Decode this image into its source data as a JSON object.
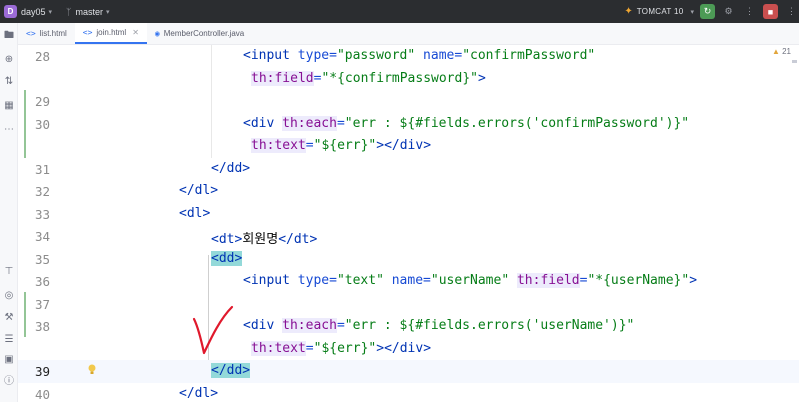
{
  "titlebar": {
    "project_badge": "D",
    "project_name": "day05",
    "branch": "master",
    "run_config": "TOMCAT 10"
  },
  "tabs": [
    {
      "label": "list.html",
      "icon": "html-file-icon",
      "active": false
    },
    {
      "label": "join.html",
      "icon": "html-file-icon",
      "active": true
    },
    {
      "label": "MemberController.java",
      "icon": "java-class-icon",
      "active": false
    }
  ],
  "editor": {
    "warnings_count": "21",
    "current_line": 39,
    "lines": [
      {
        "n": "28",
        "indent": 225
      },
      {
        "n": "",
        "indent": 235
      },
      {
        "n": "29",
        "indent": 0
      },
      {
        "n": "30",
        "indent": 225
      },
      {
        "n": "",
        "indent": 235
      },
      {
        "n": "31",
        "indent": 193
      },
      {
        "n": "32",
        "indent": 161
      },
      {
        "n": "33",
        "indent": 161
      },
      {
        "n": "34",
        "indent": 193
      },
      {
        "n": "35",
        "indent": 193
      },
      {
        "n": "36",
        "indent": 225
      },
      {
        "n": "37",
        "indent": 0
      },
      {
        "n": "38",
        "indent": 225
      },
      {
        "n": "",
        "indent": 235
      },
      {
        "n": "39",
        "indent": 193
      },
      {
        "n": "40",
        "indent": 161
      }
    ],
    "text": {
      "l28a": "<input",
      "l28b": " type=",
      "l28c": "\"password\"",
      "l28d": " name=",
      "l28e": "\"confirmPassword\"",
      "l28f": "th:field",
      "l28g": "=",
      "l28h": "\"*{confirmPassword}\"",
      "l28i": ">",
      "l30a": "<div",
      "l30b": "th:each",
      "l30c": "=",
      "l30d": "\"err : ${#fields.errors('confirmPassword')}\"",
      "l30e": "th:text",
      "l30f": "=",
      "l30g": "\"${err}\"",
      "l30h": "></div>",
      "l31": "</dd>",
      "l32": "</dl>",
      "l33": "<dl>",
      "l34a": "<dt>",
      "l34b": "회원명",
      "l34c": "</dt>",
      "l35": "<dd>",
      "l36a": "<input",
      "l36b": " type=",
      "l36c": "\"text\"",
      "l36d": " name=",
      "l36e": "\"userName\"",
      "l36f": "th:field",
      "l36g": "=",
      "l36h": "\"*{userName}\"",
      "l36i": ">",
      "l38a": "<div",
      "l38b": "th:each",
      "l38c": "=",
      "l38d": "\"err : ${#fields.errors('userName')}\"",
      "l38e": "th:text",
      "l38f": "=",
      "l38g": "\"${err}\"",
      "l38h": "></div>",
      "l39": "</dd>",
      "l40": "</dl>"
    }
  },
  "colors": {
    "accent": "#3574f0",
    "tag": "#0033b3",
    "attribute": "#174ad4",
    "thymeleaf_attr": "#871094",
    "string": "#067d17",
    "annotation_mark": "#e0192c"
  }
}
